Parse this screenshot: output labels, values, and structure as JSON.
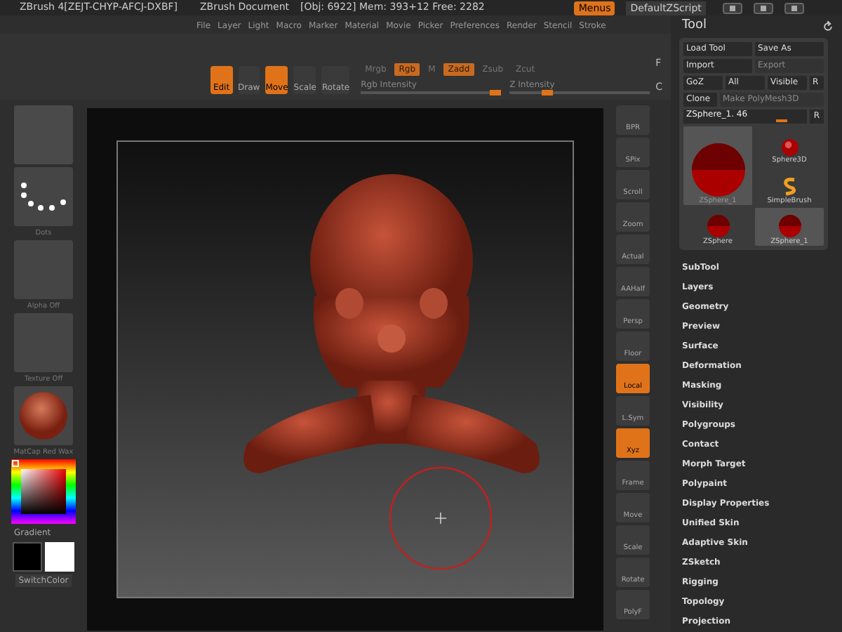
{
  "title_bar": {
    "app": "ZBrush 4[ZEJT-CHYP-AFCJ-DXBF]",
    "document": "ZBrush Document",
    "stats": "[Obj: 6922] Mem: 393+12 Free: 2282",
    "menus_button": {
      "label": "Menus",
      "selected": true
    },
    "script": "DefaultZScript"
  },
  "menu_bar": [
    "File",
    "Layer",
    "Light",
    "Macro",
    "Marker",
    "Material",
    "Movie",
    "Picker",
    "Preferences",
    "Render",
    "Stencil",
    "Stroke"
  ],
  "top_shelf": {
    "modes": [
      {
        "label": "Edit",
        "selected": true
      },
      {
        "label": "Draw",
        "selected": false
      },
      {
        "label": "Move",
        "selected": true
      },
      {
        "label": "Scale",
        "selected": false
      },
      {
        "label": "Rotate",
        "selected": false
      }
    ],
    "paint": [
      {
        "label": "Mrgb",
        "selected": false
      },
      {
        "label": "Rgb",
        "selected": true
      },
      {
        "label": "M",
        "selected": false
      },
      {
        "label": "Zadd",
        "selected": true
      },
      {
        "label": "Zsub",
        "selected": false
      },
      {
        "label": "Zcut",
        "selected": false
      }
    ],
    "sliders": [
      {
        "label": "Rgb Intensity",
        "level": 1.0
      },
      {
        "label": "Z Intensity",
        "level": 0.25
      }
    ],
    "flags": [
      "F",
      "C"
    ]
  },
  "left_shelf": {
    "thumbnails": [
      {
        "kind": "stroke",
        "label": "Dots"
      },
      {
        "kind": "blank",
        "label": "Alpha Off"
      },
      {
        "kind": "blank",
        "label": "Texture Off"
      },
      {
        "kind": "material",
        "label": "MatCap Red Wax"
      }
    ],
    "gradient": "Gradient",
    "switch": "SwitchColor"
  },
  "right_shelf": [
    {
      "label": "BPR",
      "selected": false
    },
    {
      "label": "SPix",
      "selected": false
    },
    {
      "label": "Scroll",
      "selected": false
    },
    {
      "label": "Zoom",
      "selected": false
    },
    {
      "label": "Actual",
      "selected": false
    },
    {
      "label": "AAHalf",
      "selected": false
    },
    {
      "label": "Persp",
      "selected": false
    },
    {
      "label": "Floor",
      "selected": false
    },
    {
      "label": "Local",
      "selected": true
    },
    {
      "label": "L.Sym",
      "selected": false
    },
    {
      "label": "Xyz",
      "selected": true
    },
    {
      "label": "Frame",
      "selected": false
    },
    {
      "label": "Move",
      "selected": false
    },
    {
      "label": "Scale",
      "selected": false
    },
    {
      "label": "Rotate",
      "selected": false
    },
    {
      "label": "PolyF",
      "selected": false
    }
  ],
  "tool_panel": {
    "title": "Tool",
    "button_rows": [
      [
        {
          "label": "Load Tool",
          "disabled": false
        },
        {
          "label": "Save As",
          "disabled": false
        }
      ],
      [
        {
          "label": "Import",
          "disabled": false
        },
        {
          "label": "Export",
          "disabled": true
        }
      ],
      [
        {
          "label": "GoZ",
          "disabled": false
        },
        {
          "label": "All",
          "disabled": false
        },
        {
          "label": "Visible",
          "disabled": false
        },
        {
          "label": "R",
          "disabled": false
        }
      ],
      [
        {
          "label": "Clone",
          "disabled": false
        },
        {
          "label": "Make PolyMesh3D",
          "disabled": true
        }
      ]
    ],
    "current_tool": {
      "label": "ZSphere_1. 46",
      "level": 0.85,
      "reset": "R"
    },
    "tools": [
      {
        "label": "Sphere3D",
        "kind": "sphere",
        "selected": false
      },
      {
        "label": "ZSphere_1",
        "kind": "zsphere",
        "selected": true
      },
      {
        "label": "SimpleBrush",
        "kind": "brush",
        "selected": false
      },
      {
        "label": "ZSphere",
        "kind": "zsphere",
        "selected": false
      },
      {
        "label": "ZSphere_1",
        "kind": "zsphere",
        "selected": true
      }
    ],
    "sections": [
      "SubTool",
      "Layers",
      "Geometry",
      "Preview",
      "Surface",
      "Deformation",
      "Masking",
      "Visibility",
      "Polygroups",
      "Contact",
      "Morph Target",
      "Polypaint",
      "Display Properties",
      "Unified Skin",
      "Adaptive Skin",
      "ZSketch",
      "Rigging",
      "Topology",
      "Projection"
    ]
  }
}
